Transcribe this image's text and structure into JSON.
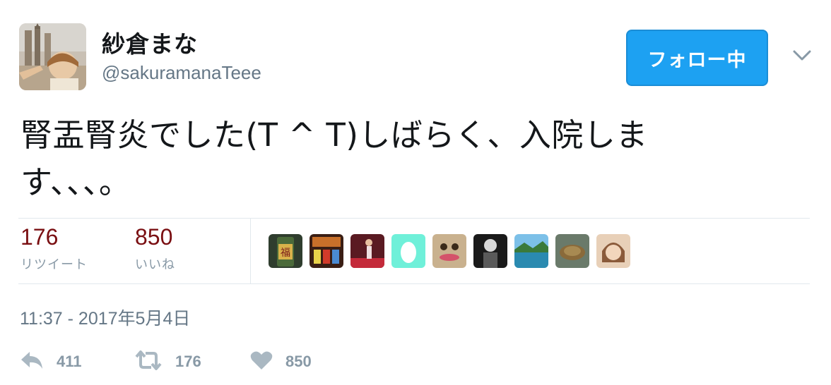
{
  "user": {
    "display_name": "紗倉まな",
    "handle": "@sakuramanaTeee"
  },
  "follow_button": {
    "label": "フォロー中"
  },
  "tweet": {
    "text": "腎盂腎炎でした(T ^ T)しばらく、入院しま\nす、、、。",
    "timestamp": "11:37 - 2017年5月4日"
  },
  "stats": {
    "retweets": {
      "count": "176",
      "label": "リツイート"
    },
    "likes": {
      "count": "850",
      "label": "いいね"
    }
  },
  "likers": [
    {
      "icon": "avatar-can"
    },
    {
      "icon": "avatar-pachinko"
    },
    {
      "icon": "avatar-dancer"
    },
    {
      "icon": "avatar-egg"
    },
    {
      "icon": "avatar-face"
    },
    {
      "icon": "avatar-skull"
    },
    {
      "icon": "avatar-lake"
    },
    {
      "icon": "avatar-turtle"
    },
    {
      "icon": "avatar-girl"
    }
  ],
  "actions": {
    "reply": {
      "count": "411"
    },
    "retweet": {
      "count": "176"
    },
    "like": {
      "count": "850"
    }
  },
  "colors": {
    "accent": "#1da1f2",
    "stat_number": "#7a0f12",
    "muted": "#657786",
    "action_gray": "#aab8c2"
  }
}
